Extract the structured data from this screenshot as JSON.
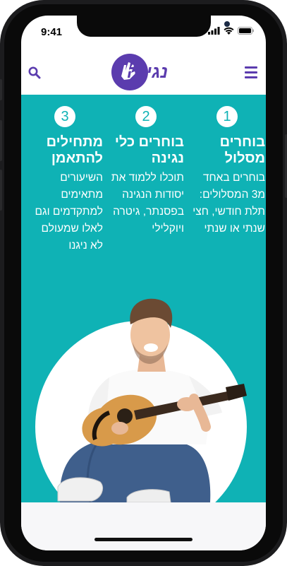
{
  "status_bar": {
    "time": "9:41",
    "icons": [
      "signal-icon",
      "wifi-icon",
      "battery-icon"
    ]
  },
  "header": {
    "logo_text": "נגינה",
    "menu_icon": "hamburger-menu-icon",
    "search_icon": "search-icon"
  },
  "steps": [
    {
      "number": "1",
      "title": "בוחרים מסלול",
      "text": "בוחרים באחד מ3 המסלולים: תלת חודשי, חצי שנתי או שנתי"
    },
    {
      "number": "2",
      "title": "בוחרים כלי נגינה",
      "text": "תוכלו ללמוד את יסודות הנגינה בפסנתר, גיטרה ויוקלילי"
    },
    {
      "number": "3",
      "title": "מתחילים להתאמן",
      "text": "השיעורים מתאימים למתקדמים וגם לאלו שמעולם לא ניגנו"
    }
  ],
  "chat": {
    "icon": "chat-bubble-icon"
  },
  "colors": {
    "brand_purple": "#5b3cae",
    "hero_teal": "#0fb2b5",
    "chat_blue": "#1277e1"
  }
}
